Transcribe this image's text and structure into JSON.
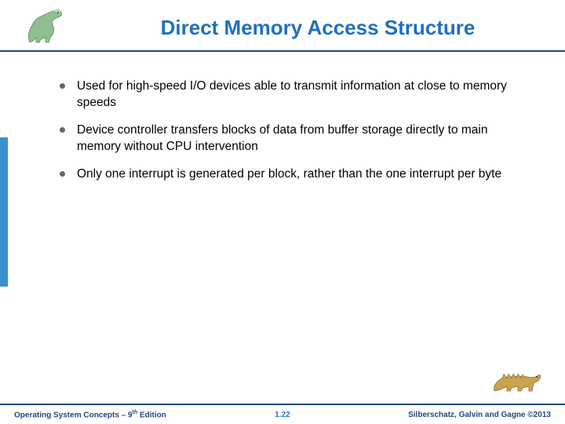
{
  "title": "Direct Memory Access Structure",
  "bullets": [
    "Used for high-speed I/O devices able to transmit information at close to memory speeds",
    "Device controller transfers blocks of data from buffer storage directly to main memory without CPU intervention",
    "Only one interrupt is generated per block, rather than the one interrupt per byte"
  ],
  "footer": {
    "left_prefix": "Operating System Concepts – 9",
    "left_suffix": " Edition",
    "left_sup": "th",
    "page": "1.22",
    "right": "Silberschatz, Galvin and Gagne ©2013"
  }
}
